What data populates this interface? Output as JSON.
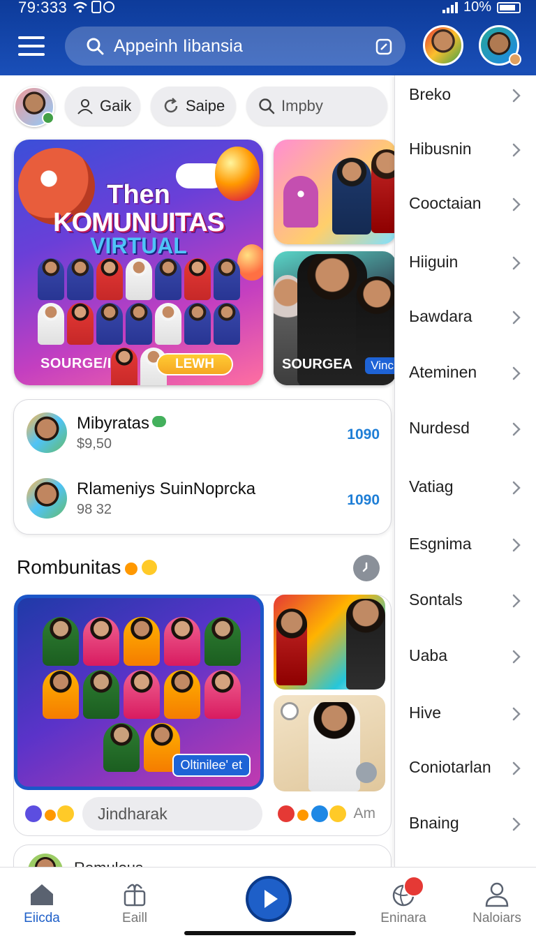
{
  "status_bar": {
    "time": "79:333",
    "battery": "10%"
  },
  "header": {
    "search_text": "Appeinh Iibansia"
  },
  "chips": [
    {
      "label": "Gaik",
      "icon": "person-icon"
    },
    {
      "label": "Saipe",
      "icon": "refresh-icon"
    },
    {
      "label": "Impby",
      "icon": "search-icon"
    }
  ],
  "hero": {
    "title_line1": "Then",
    "title_line2": "KOMUNUITAS",
    "title_line3": "VIRTUAL",
    "source": "SOURGE/I",
    "button": "LEWH"
  },
  "side_thumb": {
    "source": "SOURGEA",
    "tag": "Vinc"
  },
  "list_card": {
    "rows": [
      {
        "name": "Mibyratas",
        "sub": "$9,50",
        "value": "1090"
      },
      {
        "name": "Rlameniys SuinNoprcka",
        "sub": "98 32",
        "value": "1090"
      }
    ]
  },
  "section": {
    "title": "Rombunitas",
    "big_tag": "Oltinilee' et",
    "comment_placeholder": "Jindharak",
    "comment_time": "Am",
    "next_card_name": "Romulous"
  },
  "drawer": {
    "items": [
      "Breko",
      "Hibusnin",
      "Cooctaian",
      "Hiiguin",
      "Ьawdara",
      "Ateminen",
      "Nurdesd",
      "Vatiag",
      "Esgnima",
      "Sontals",
      "Uaba",
      "Hive",
      "Coniotarlan",
      "Bnaing"
    ]
  },
  "bottom_nav": {
    "items": [
      {
        "label": "Eiicda",
        "icon": "home-icon"
      },
      {
        "label": "Eaill",
        "icon": "gift-icon"
      },
      {
        "label": "Eninara",
        "icon": "globe-icon"
      },
      {
        "label": "Naloiars",
        "icon": "profile-icon"
      }
    ]
  },
  "colors": {
    "header": "#0d3b9a",
    "accent": "#1e5fc8",
    "value_blue": "#1e7ed6"
  }
}
